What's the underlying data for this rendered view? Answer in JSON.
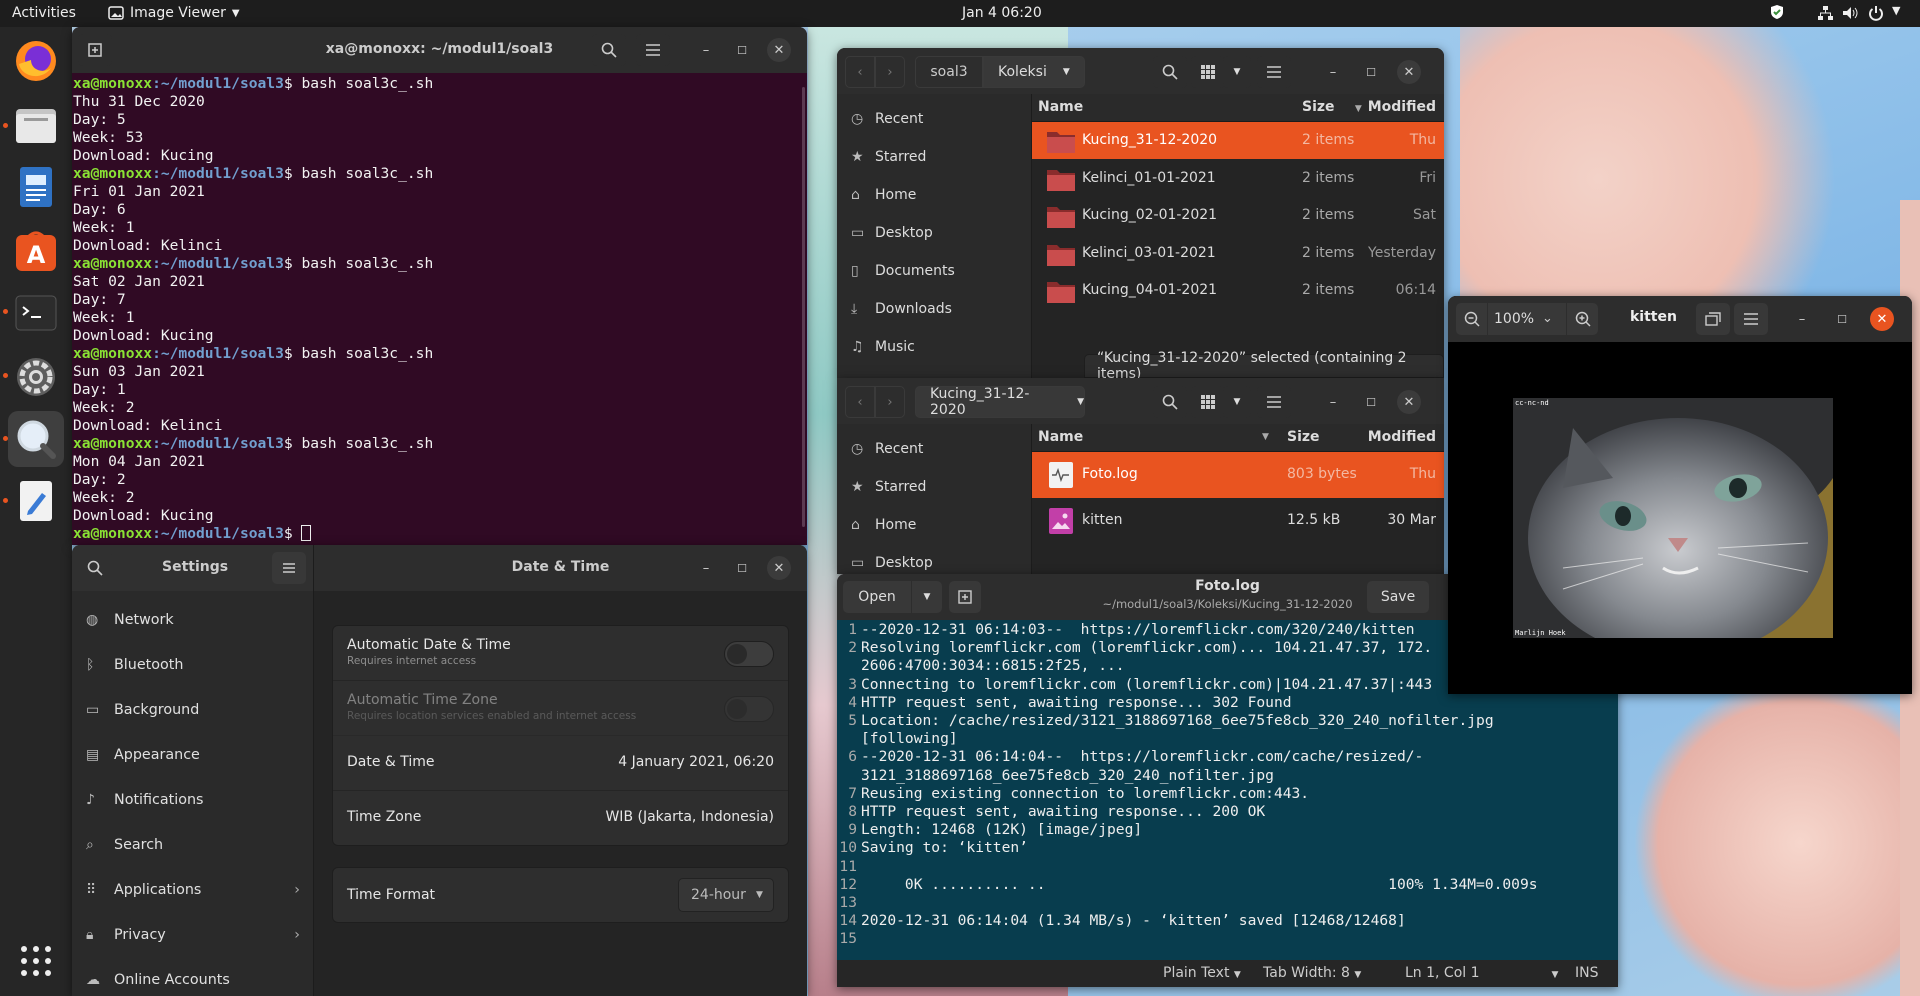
{
  "topbar": {
    "activities": "Activities",
    "app_menu": "Image Viewer",
    "clock": "Jan 4  06:20"
  },
  "dock": {
    "items": [
      "firefox-icon",
      "files-icon",
      "text-document-icon",
      "software-store-icon",
      "terminal-icon",
      "settings-icon",
      "image-viewer-icon",
      "text-editor-icon"
    ],
    "show_apps": "show-applications-icon"
  },
  "terminal": {
    "title": "xa@monoxx: ~/modul1/soal3",
    "prompt_user": "xa@monoxx",
    "prompt_path": ":~/modul1/soal3",
    "runs": [
      {
        "cmd": "$ bash soal3c_.sh",
        "out": [
          "Thu 31 Dec 2020",
          "Day: 5",
          "Week: 53",
          "Download: Kucing"
        ]
      },
      {
        "cmd": "$ bash soal3c_.sh",
        "out": [
          "Fri 01 Jan 2021",
          "Day: 6",
          "Week: 1",
          "Download: Kelinci"
        ]
      },
      {
        "cmd": "$ bash soal3c_.sh",
        "out": [
          "Sat 02 Jan 2021",
          "Day: 7",
          "Week: 1",
          "Download: Kucing"
        ]
      },
      {
        "cmd": "$ bash soal3c_.sh",
        "out": [
          "Sun 03 Jan 2021",
          "Day: 1",
          "Week: 2",
          "Download: Kelinci"
        ]
      },
      {
        "cmd": "$ bash soal3c_.sh",
        "out": [
          "Mon 04 Jan 2021",
          "Day: 2",
          "Week: 2",
          "Download: Kucing"
        ]
      }
    ],
    "final_prompt": "$ "
  },
  "settings": {
    "sidebar_title": "Settings",
    "panel_title": "Date & Time",
    "sidebar": [
      {
        "label": "Network",
        "icon": "network-icon"
      },
      {
        "label": "Bluetooth",
        "icon": "bluetooth-icon"
      },
      {
        "label": "Background",
        "icon": "background-icon"
      },
      {
        "label": "Appearance",
        "icon": "appearance-icon"
      },
      {
        "label": "Notifications",
        "icon": "bell-icon"
      },
      {
        "label": "Search",
        "icon": "search-icon"
      },
      {
        "label": "Applications",
        "icon": "applications-icon"
      },
      {
        "label": "Privacy",
        "icon": "lock-icon"
      },
      {
        "label": "Online Accounts",
        "icon": "cloud-icon"
      }
    ],
    "auto_dt": {
      "label": "Automatic Date & Time",
      "sub": "Requires internet access"
    },
    "auto_tz": {
      "label": "Automatic Time Zone",
      "sub": "Requires location services enabled and internet access"
    },
    "date_time": {
      "label": "Date & Time",
      "value": "4 January 2021, 06:20"
    },
    "time_zone": {
      "label": "Time Zone",
      "value": "WIB (Jakarta, Indonesia)"
    },
    "time_format": {
      "label": "Time Format",
      "value": "24-hour"
    }
  },
  "fm1": {
    "path": [
      "soal3",
      "Koleksi"
    ],
    "sidebar": [
      "Recent",
      "Starred",
      "Home",
      "Desktop",
      "Documents",
      "Downloads",
      "Music"
    ],
    "cols": {
      "name": "Name",
      "size": "Size",
      "modified": "Modified"
    },
    "rows": [
      {
        "name": "Kucing_31-12-2020",
        "size": "2 items",
        "modified": "Thu"
      },
      {
        "name": "Kelinci_01-01-2021",
        "size": "2 items",
        "modified": "Fri"
      },
      {
        "name": "Kucing_02-01-2021",
        "size": "2 items",
        "modified": "Sat"
      },
      {
        "name": "Kelinci_03-01-2021",
        "size": "2 items",
        "modified": "Yesterday"
      },
      {
        "name": "Kucing_04-01-2021",
        "size": "2 items",
        "modified": "06:14"
      }
    ],
    "status": "“Kucing_31-12-2020” selected  (containing 2 items)"
  },
  "fm2": {
    "path": "Kucing_31-12-2020",
    "sidebar": [
      "Recent",
      "Starred",
      "Home",
      "Desktop"
    ],
    "cols": {
      "name": "Name",
      "size": "Size",
      "modified": "Modified"
    },
    "rows": [
      {
        "name": "Foto.log",
        "size": "803 bytes",
        "modified": "Thu"
      },
      {
        "name": "kitten",
        "size": "12.5 kB",
        "modified": "30 Mar"
      }
    ]
  },
  "editor": {
    "open": "Open",
    "save": "Save",
    "title": "Foto.log",
    "subtitle": "~/modul1/soal3/Koleksi/Kucing_31-12-2020",
    "lines": [
      {
        "n": "1",
        "t": "--2020-12-31 06:14:03--  https://loremflickr.com/320/240/kitten"
      },
      {
        "n": "2",
        "t": "Resolving loremflickr.com (loremflickr.com)... 104.21.47.37, 172."
      },
      {
        "n": "",
        "t": "2606:4700:3034::6815:2f25, ..."
      },
      {
        "n": "3",
        "t": "Connecting to loremflickr.com (loremflickr.com)|104.21.47.37|:443"
      },
      {
        "n": "4",
        "t": "HTTP request sent, awaiting response... 302 Found"
      },
      {
        "n": "5",
        "t": "Location: /cache/resized/3121_3188697168_6ee75fe8cb_320_240_nofilter.jpg"
      },
      {
        "n": "",
        "t": "[following]"
      },
      {
        "n": "6",
        "t": "--2020-12-31 06:14:04--  https://loremflickr.com/cache/resized/-"
      },
      {
        "n": "",
        "t": "3121_3188697168_6ee75fe8cb_320_240_nofilter.jpg"
      },
      {
        "n": "7",
        "t": "Reusing existing connection to loremflickr.com:443."
      },
      {
        "n": "8",
        "t": "HTTP request sent, awaiting response... 200 OK"
      },
      {
        "n": "9",
        "t": "Length: 12468 (12K) [image/jpeg]"
      },
      {
        "n": "10",
        "t": "Saving to: ‘kitten’"
      },
      {
        "n": "11",
        "t": ""
      },
      {
        "n": "12",
        "t": "     0K .......... ..                                       100% 1.34M=0.009s"
      },
      {
        "n": "13",
        "t": ""
      },
      {
        "n": "14",
        "t": "2020-12-31 06:14:04 (1.34 MB/s) - ‘kitten’ saved [12468/12468]"
      },
      {
        "n": "15",
        "t": ""
      }
    ],
    "status": {
      "lang": "Plain Text",
      "tab": "Tab Width: 8",
      "pos": "Ln 1, Col 1",
      "mode": "INS"
    }
  },
  "viewer": {
    "zoom": "100%",
    "title": "kitten",
    "caption_top": "cc-nc-nd",
    "caption_bottom": "Marlijn Hoek"
  },
  "colors": {
    "accent": "#e95420",
    "terminal_bg": "#300a24",
    "editor_bg": "#083d4e"
  }
}
